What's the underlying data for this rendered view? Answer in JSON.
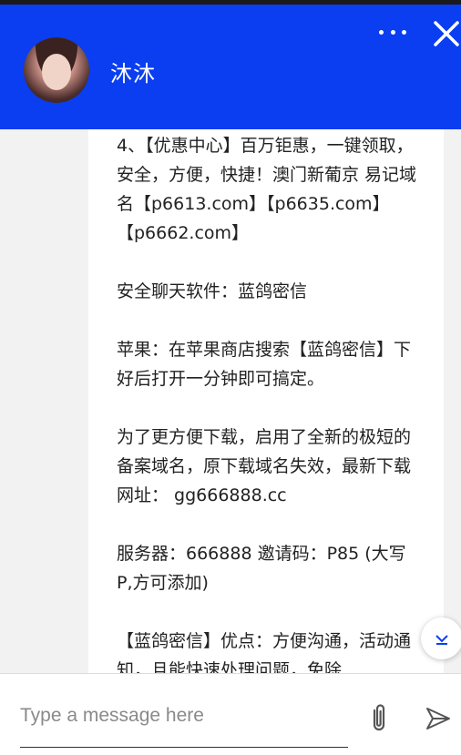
{
  "header": {
    "contact_name": "沐沐",
    "more_icon": "more-dots-icon",
    "close_icon": "close-icon",
    "background_color": "#0a3ef0"
  },
  "message": {
    "lines": [
      "4、【优惠中心】百万钜惠，一键领取，安全，方便，快捷！澳门新葡京 易记域名【p6613.com】【p6635.com】【p6662.com】",
      "",
      "安全聊天软件：蓝鸽密信",
      "",
      "苹果：在苹果商店搜索【蓝鸽密信】下好后打开一分钟即可搞定。",
      "",
      "为了更方便下载，启用了全新的极短的备案域名，原下载域名失效，最新下载网址：  gg666888.cc",
      "",
      "服务器：666888 邀请码：P85 (大写P,方可添加)",
      "",
      "【蓝鸽密信】优点：方便沟通，活动通知，且能快速处理问题，免除"
    ]
  },
  "composer": {
    "placeholder": "Type a message here",
    "attach_icon": "paperclip-icon",
    "send_icon": "send-icon"
  },
  "scroll_button_icon": "chevron-down-icon"
}
